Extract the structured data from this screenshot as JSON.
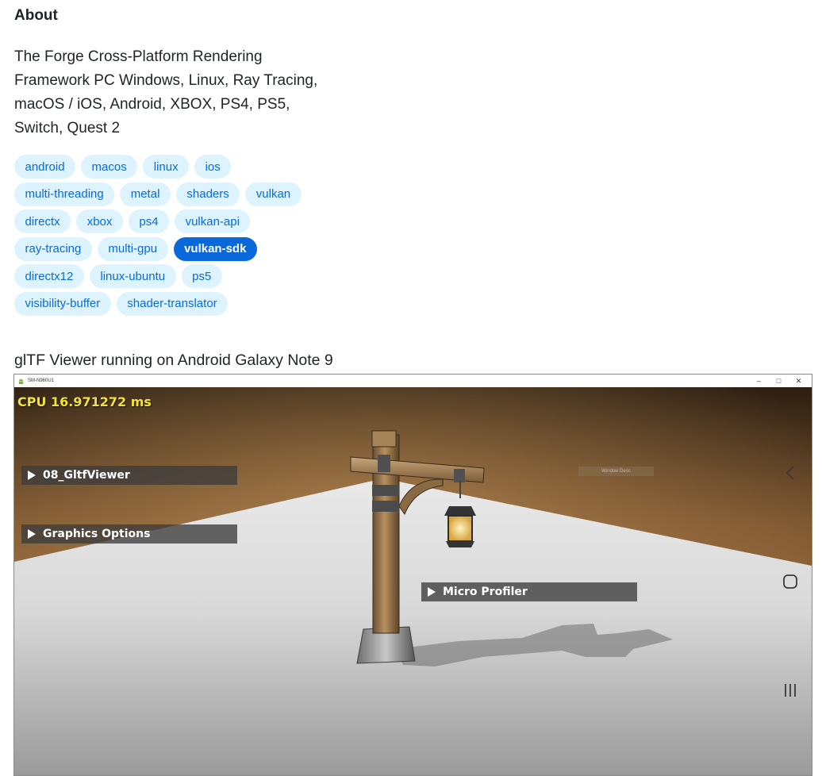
{
  "about": {
    "heading": "About",
    "description": "The Forge Cross-Platform Rendering Framework PC Windows, Linux, Ray Tracing, macOS / iOS, Android, XBOX, PS4, PS5, Switch, Quest 2"
  },
  "topics": [
    [
      "android",
      "macos",
      "linux",
      "ios"
    ],
    [
      "multi-threading",
      "metal",
      "shaders",
      "vulkan"
    ],
    [
      "directx",
      "xbox",
      "ps4",
      "vulkan-api"
    ],
    [
      "ray-tracing",
      "multi-gpu",
      "vulkan-sdk"
    ],
    [
      "directx12",
      "linux-ubuntu",
      "ps5"
    ],
    [
      "visibility-buffer",
      "shader-translator"
    ]
  ],
  "active_topic": "vulkan-sdk",
  "colors": {
    "topic_bg": "#ddf4ff",
    "topic_text": "#0969da",
    "topic_active_bg": "#0969da",
    "cpu_text": "#f3e23a"
  },
  "caption": "glTF Viewer running on Android Galaxy Note 9",
  "app_window": {
    "title": "SM-N960U1",
    "icon": "android-icon",
    "controls": {
      "minimize": "–",
      "maximize": "□",
      "close": "✕"
    },
    "cpu_readout": "CPU 16.971272 ms",
    "panels": {
      "viewer": "08_GltfViewer",
      "graphics": "Graphics Options",
      "profiler": "Micro Profiler"
    },
    "faint_label": "Window Desc",
    "nav_buttons": [
      "back-icon",
      "home-icon",
      "recents-icon"
    ]
  }
}
